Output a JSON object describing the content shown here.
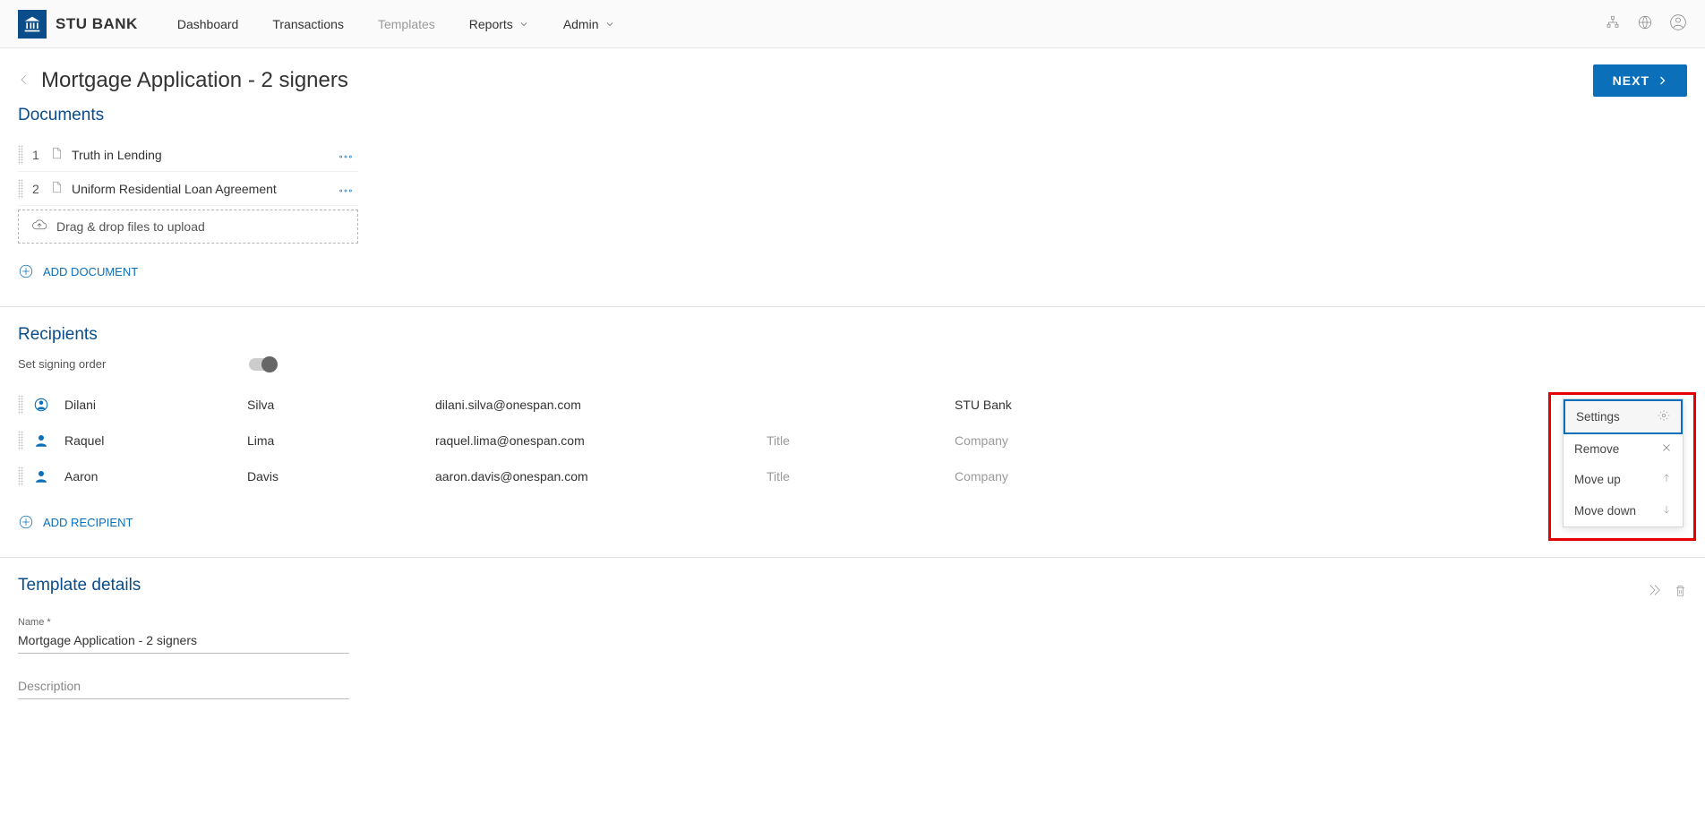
{
  "brand": {
    "name": "STU BANK"
  },
  "nav": {
    "items": [
      {
        "label": "Dashboard",
        "active": false,
        "dropdown": false
      },
      {
        "label": "Transactions",
        "active": false,
        "dropdown": false
      },
      {
        "label": "Templates",
        "active": true,
        "dropdown": false
      },
      {
        "label": "Reports",
        "active": false,
        "dropdown": true
      },
      {
        "label": "Admin",
        "active": false,
        "dropdown": true
      }
    ]
  },
  "page": {
    "title": "Mortgage Application - 2 signers",
    "next_label": "NEXT"
  },
  "documents": {
    "heading": "Documents",
    "items": [
      {
        "num": "1",
        "name": "Truth in Lending"
      },
      {
        "num": "2",
        "name": "Uniform Residential Loan Agreement"
      }
    ],
    "drop_label": "Drag & drop files to upload",
    "add_label": "ADD DOCUMENT"
  },
  "recipients": {
    "heading": "Recipients",
    "signing_order_label": "Set signing order",
    "add_label": "ADD RECIPIENT",
    "placeholders": {
      "title": "Title",
      "company": "Company"
    },
    "rows": [
      {
        "type": "sender",
        "first": "Dilani",
        "last": "Silva",
        "email": "dilani.silva@onespan.com",
        "title": "",
        "company": "STU Bank"
      },
      {
        "type": "signer",
        "first": "Raquel",
        "last": "Lima",
        "email": "raquel.lima@onespan.com",
        "title": "",
        "company": ""
      },
      {
        "type": "signer",
        "first": "Aaron",
        "last": "Davis",
        "email": "aaron.davis@onespan.com",
        "title": "",
        "company": ""
      }
    ]
  },
  "context_menu": {
    "items": [
      {
        "label": "Settings",
        "icon": "gear",
        "selected": true
      },
      {
        "label": "Remove",
        "icon": "close",
        "selected": false
      },
      {
        "label": "Move up",
        "icon": "arrow-up",
        "selected": false
      },
      {
        "label": "Move down",
        "icon": "arrow-down",
        "selected": false
      }
    ]
  },
  "details": {
    "heading": "Template details",
    "name_label": "Name *",
    "name_value": "Mortgage Application - 2 signers",
    "description_placeholder": "Description"
  }
}
